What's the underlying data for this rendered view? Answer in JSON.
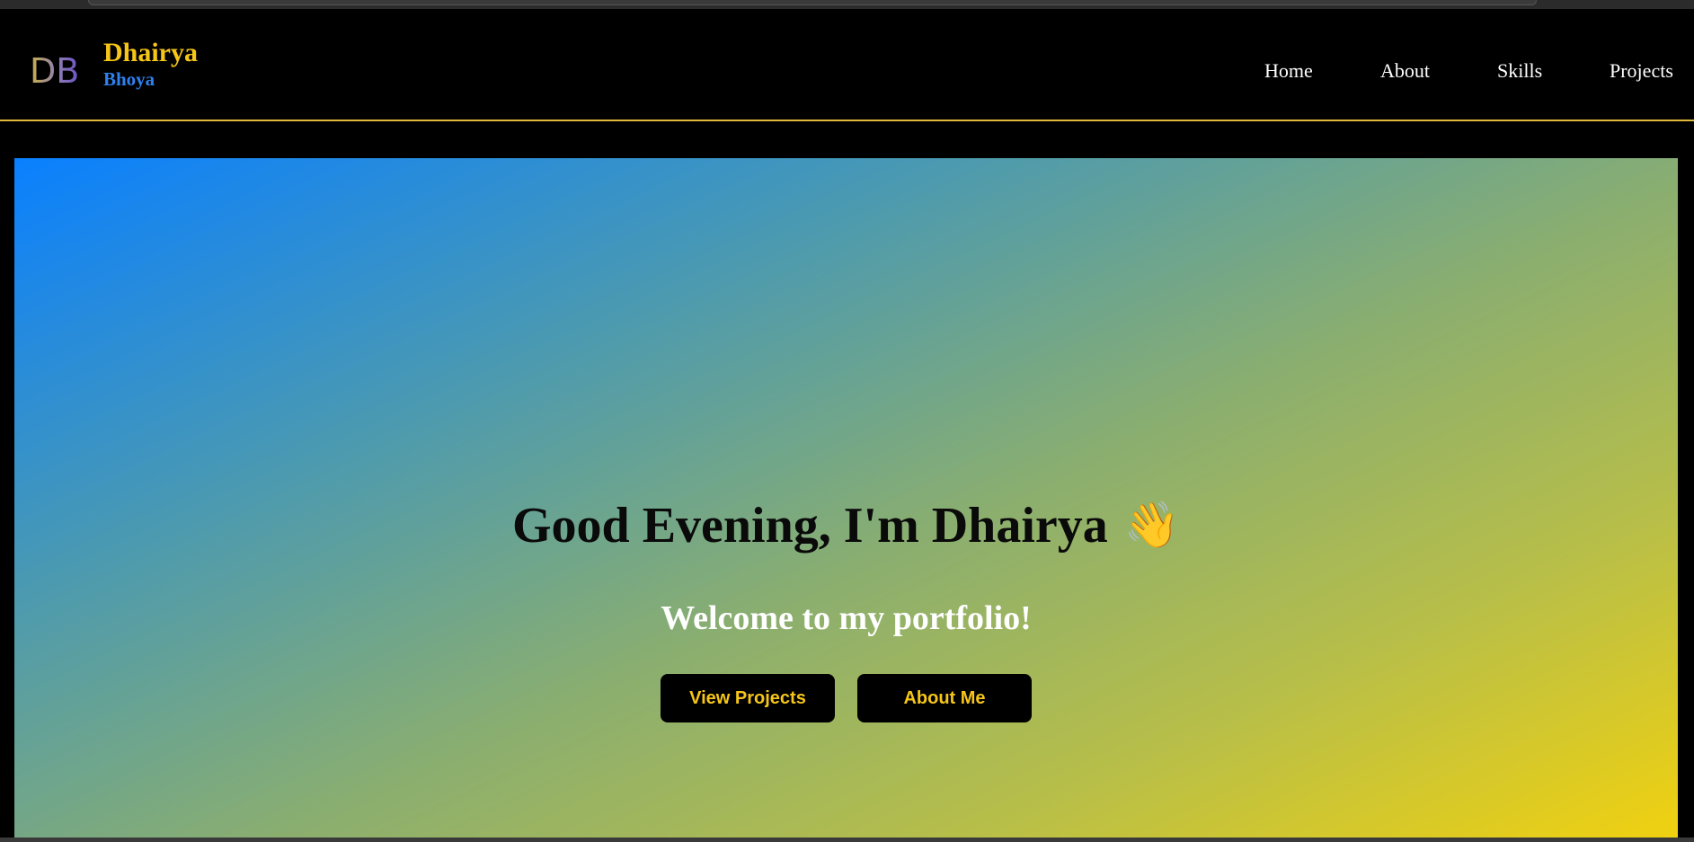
{
  "brand": {
    "logo_initials": "DB",
    "first_name": "Dhairya",
    "last_name": "Bhoya"
  },
  "nav": {
    "items": [
      {
        "label": "Home"
      },
      {
        "label": "About"
      },
      {
        "label": "Skills"
      },
      {
        "label": "Projects"
      }
    ]
  },
  "hero": {
    "title": "Good Evening, I'm Dhairya",
    "wave_emoji": "👋",
    "subtitle": "Welcome to my portfolio!",
    "primary_button": "View Projects",
    "secondary_button": "About Me"
  },
  "colors": {
    "accent_yellow": "#f5c518",
    "accent_blue": "#2f80ed",
    "background": "#000000",
    "gradient_start": "#0a80ff",
    "gradient_end": "#f0d110"
  }
}
